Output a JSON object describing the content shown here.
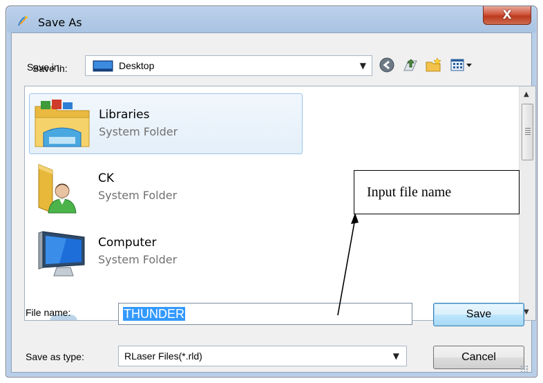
{
  "window": {
    "title": "Save As",
    "close_glyph": "X"
  },
  "savein": {
    "label": "Save in:",
    "value": "Desktop",
    "icon": "desktop-icon"
  },
  "toolbar": {
    "icons": [
      "back-icon",
      "up-folder-icon",
      "new-folder-icon",
      "view-menu-icon"
    ]
  },
  "items": [
    {
      "name": "Libraries",
      "type": "System Folder",
      "icon": "libraries-folder-icon",
      "selected": true
    },
    {
      "name": "CK",
      "type": "System Folder",
      "icon": "user-folder-icon",
      "selected": false
    },
    {
      "name": "Computer",
      "type": "System Folder",
      "icon": "computer-icon",
      "selected": false
    }
  ],
  "filename": {
    "label": "File name:",
    "value": "THUNDER"
  },
  "savetype": {
    "label": "Save as type:",
    "value": "RLaser Files(*.rld)"
  },
  "buttons": {
    "save": "Save",
    "cancel": "Cancel"
  },
  "annotation": {
    "text": "Input file name"
  },
  "colors": {
    "selection": "#3399ff",
    "close": "#c7432a",
    "default_button": "#3c7fb1"
  }
}
